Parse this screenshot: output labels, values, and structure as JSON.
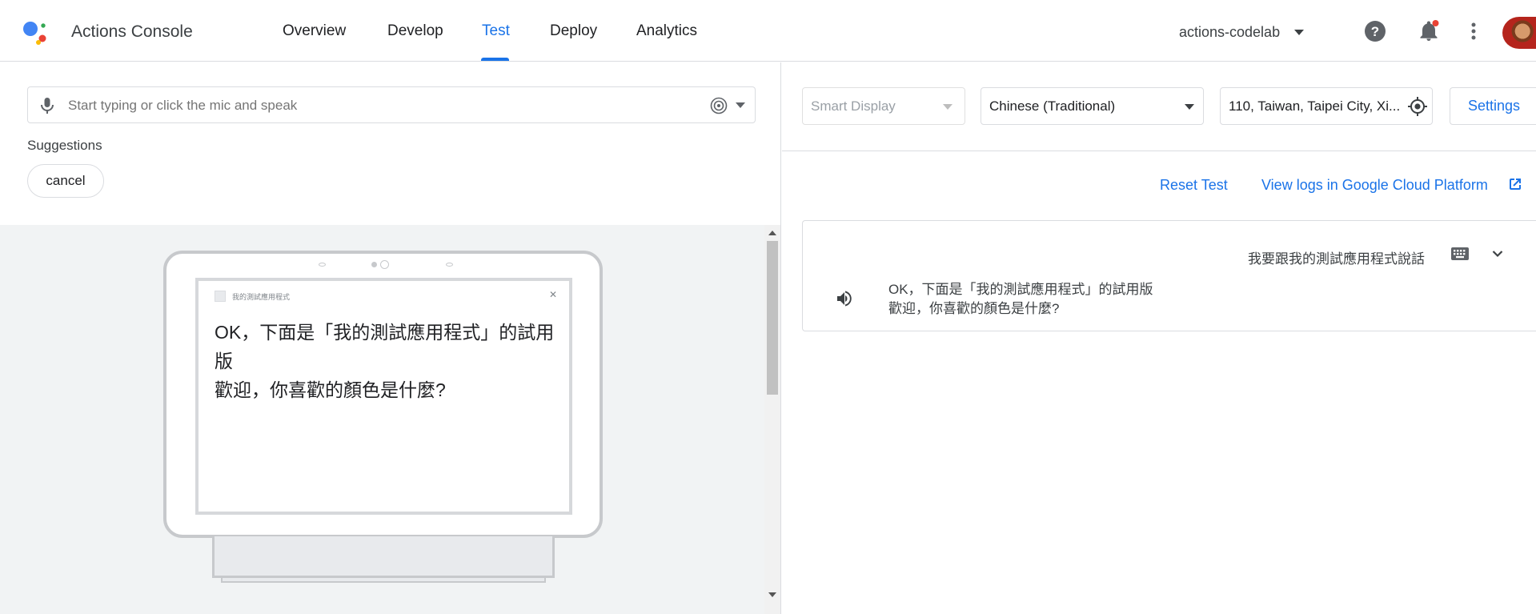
{
  "header": {
    "app_title": "Actions Console",
    "tabs": [
      {
        "label": "Overview"
      },
      {
        "label": "Develop"
      },
      {
        "label": "Test"
      },
      {
        "label": "Deploy"
      },
      {
        "label": "Analytics"
      }
    ],
    "active_tab": "Test",
    "project_name": "actions-codelab",
    "icons": [
      "help-icon",
      "notifications-icon",
      "more-vert-icon"
    ],
    "accent_color": "#1a73e8",
    "notification_badge_color": "#ea4335"
  },
  "input": {
    "placeholder": "Start typing or click the mic and speak"
  },
  "suggestions": {
    "label": "Suggestions",
    "chips": [
      "cancel"
    ]
  },
  "simulator": {
    "screen_app_name": "我的測試應用程式",
    "screen_text_line1": "OK，下面是「我的測試應用程式」的試用版",
    "screen_text_line2": "歡迎，你喜歡的顏色是什麼?"
  },
  "settings_bar": {
    "surface": "Smart Display",
    "language": "Chinese (Traditional)",
    "location": "110, Taiwan, Taipei City, Xi...",
    "settings_label": "Settings"
  },
  "actions": {
    "reset_test": "Reset Test",
    "view_logs": "View logs in Google Cloud Platform"
  },
  "conversation": {
    "user_query": "我要跟我的測試應用程式說話",
    "response_line1": "OK，下面是「我的測試應用程式」的試用版",
    "response_line2": "歡迎，你喜歡的顏色是什麼?"
  }
}
